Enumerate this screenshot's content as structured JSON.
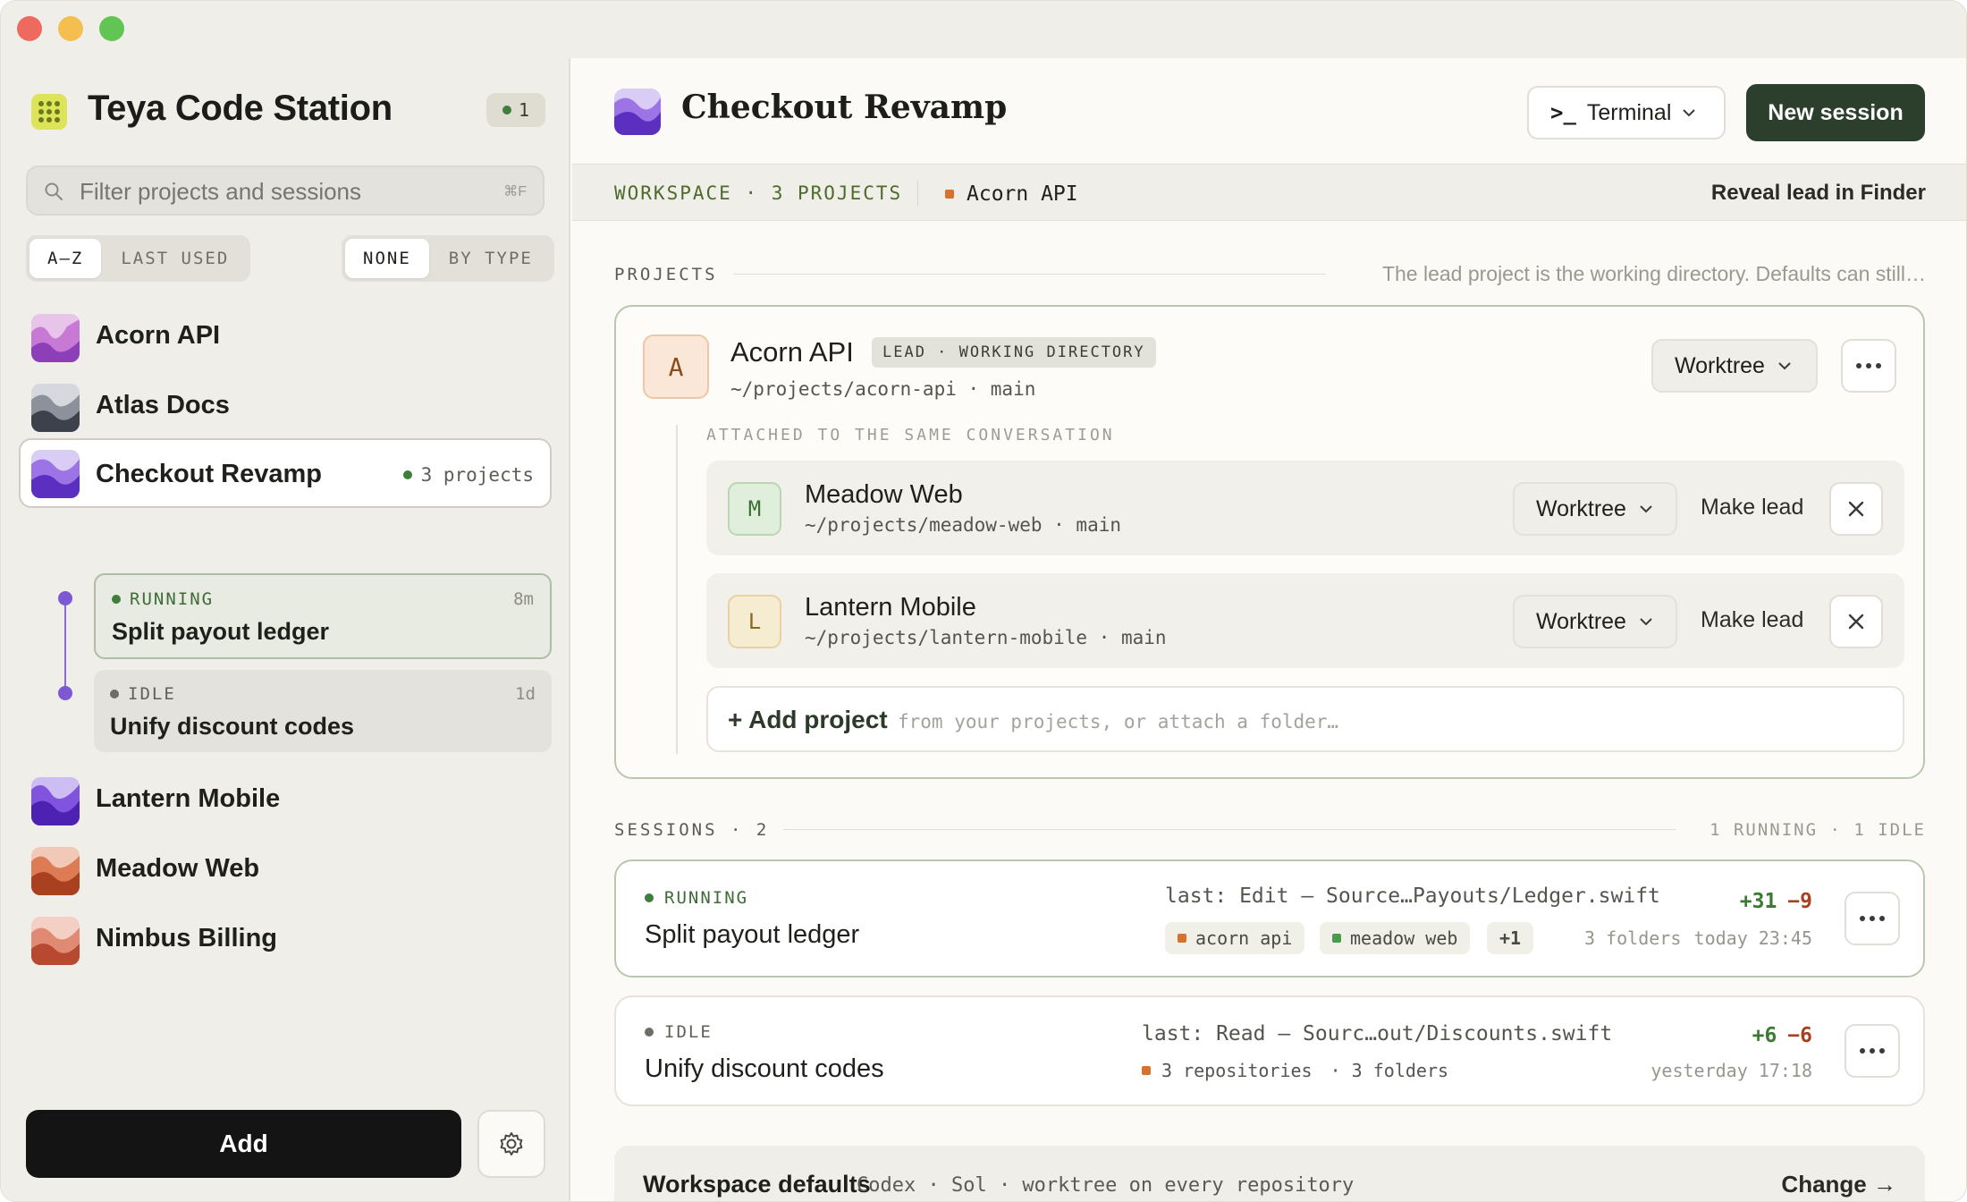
{
  "colors": {
    "accent": "#2c3f2d",
    "running": "#3f7d3b",
    "idle": "#6d6d68",
    "diff_add": "#3c7a33",
    "diff_del": "#a7401e"
  },
  "sidebar": {
    "app_title": "Teya Code Station",
    "running_count": "1",
    "search": {
      "placeholder": "Filter projects and sessions",
      "shortcut": "⌘F"
    },
    "sort": {
      "az": "A–Z",
      "last_used": "LAST USED"
    },
    "group": {
      "none": "NONE",
      "by_type": "BY TYPE"
    },
    "projects": [
      {
        "name": "Acorn API"
      },
      {
        "name": "Atlas Docs"
      },
      {
        "name": "Checkout Revamp",
        "meta": "3 projects"
      },
      {
        "name": "Lantern Mobile"
      },
      {
        "name": "Meadow Web"
      },
      {
        "name": "Nimbus Billing"
      }
    ],
    "sessions": [
      {
        "status": "RUNNING",
        "time": "8m",
        "title": "Split payout ledger"
      },
      {
        "status": "IDLE",
        "time": "1d",
        "title": "Unify discount codes"
      }
    ],
    "add_label": "Add"
  },
  "header": {
    "title": "Checkout Revamp",
    "terminal_label": "Terminal",
    "terminal_prompt": ">_",
    "new_session_label": "New session"
  },
  "workspace_bar": {
    "label": "WORKSPACE · 3 PROJECTS",
    "lead": "Acorn API",
    "reveal": "Reveal lead in Finder"
  },
  "projects_section": {
    "heading": "PROJECTS",
    "note": "The lead project is the working directory. Defaults can still…",
    "lead": {
      "initial": "A",
      "name": "Acorn API",
      "badge": "LEAD · WORKING DIRECTORY",
      "path": "~/projects/acorn-api · main",
      "mode": "Worktree"
    },
    "attached_label": "ATTACHED TO THE SAME CONVERSATION",
    "attached": [
      {
        "initial": "M",
        "name": "Meadow Web",
        "path": "~/projects/meadow-web · main",
        "mode": "Worktree",
        "action": "Make lead"
      },
      {
        "initial": "L",
        "name": "Lantern Mobile",
        "path": "~/projects/lantern-mobile · main",
        "mode": "Worktree",
        "action": "Make lead"
      }
    ],
    "add_project": {
      "label": "+ Add project",
      "hint": "from your projects, or attach a folder…"
    }
  },
  "sessions_section": {
    "heading": "SESSIONS · 2",
    "summary": "1 RUNNING · 1 IDLE",
    "rows": [
      {
        "status": "RUNNING",
        "title": "Split payout ledger",
        "last": "last: Edit — Source…Payouts/Ledger.swift",
        "chips": [
          "acorn api",
          "meadow web",
          "+1"
        ],
        "extra": "3 folders",
        "added": "+31",
        "removed": "−9",
        "time": "today 23:45"
      },
      {
        "status": "IDLE",
        "title": "Unify discount codes",
        "last": "last: Read — Sourc…out/Discounts.swift",
        "repos": "3 repositories",
        "extra": "· 3 folders",
        "added": "+6",
        "removed": "−6",
        "time": "yesterday 17:18"
      }
    ]
  },
  "defaults": {
    "title": "Workspace defaults",
    "detail": "Codex · Sol · worktree on every repository",
    "change": "Change →"
  }
}
